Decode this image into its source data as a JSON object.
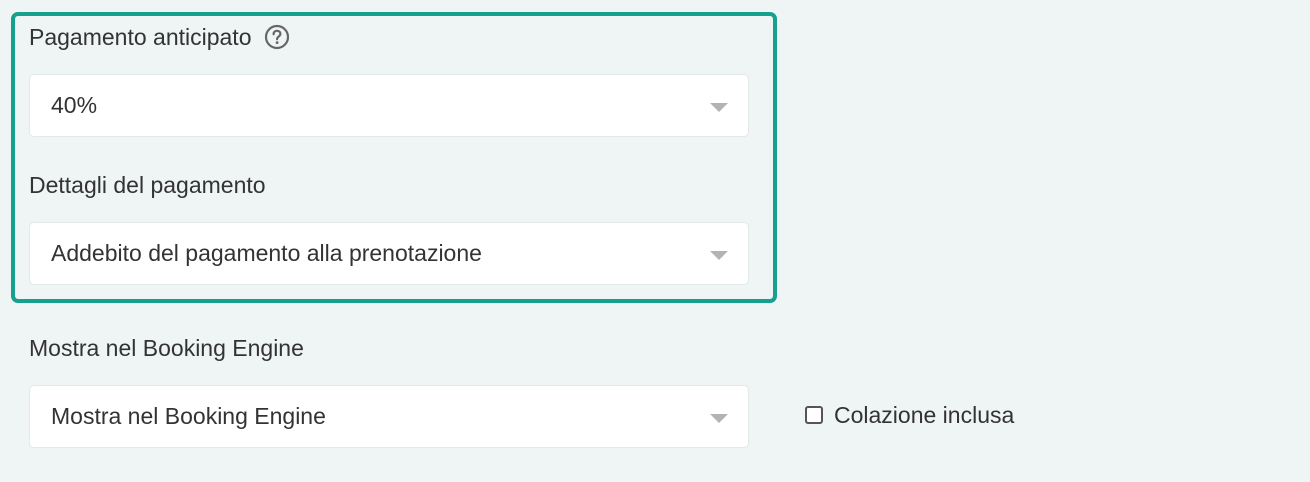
{
  "advance_payment": {
    "label": "Pagamento anticipato",
    "help_icon": "question-circle-icon",
    "selected_value": "40%"
  },
  "payment_details": {
    "label": "Dettagli del pagamento",
    "selected_value": "Addebito del pagamento alla prenotazione"
  },
  "booking_engine": {
    "label": "Mostra nel Booking Engine",
    "selected_value": "Mostra nel Booking Engine"
  },
  "breakfast": {
    "label": "Colazione inclusa",
    "checked": false
  },
  "colors": {
    "highlight_border": "#16a08d",
    "background": "#eff4f4",
    "text": "#333333"
  }
}
